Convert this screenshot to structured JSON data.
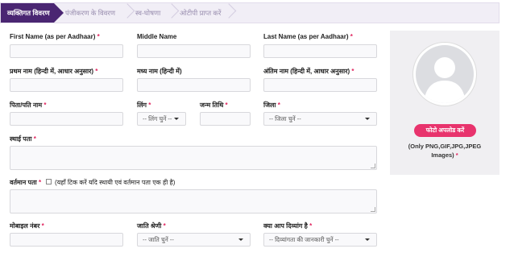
{
  "wizard": {
    "steps": [
      "व्यक्तिगत विवरण",
      "पंजीकरण के विवरण",
      "स्व-घोषणा",
      "ओटीपी प्राप्त करें"
    ]
  },
  "form": {
    "first_name_label": "First Name (as per Aadhaar)",
    "middle_name_label": "Middle Name",
    "last_name_label": "Last Name (as per Aadhaar)",
    "first_name_hi_label": "प्रथम नाम (हिन्दी में, आधार अनुसार)",
    "middle_name_hi_label": "मध्य नाम (हिन्दी में)",
    "last_name_hi_label": "अंतिम नाम (हिन्दी में, आधार अनुसार)",
    "father_husband_label": "पिता/पति नाम",
    "gender_label": "लिंग",
    "gender_placeholder": "-- लिंग चुनें --",
    "dob_label": "जन्म तिथि",
    "district_label": "जिला",
    "district_placeholder": "-- जिला चुनें --",
    "permanent_address_label": "स्थाई पता",
    "current_address_label": "वर्तमान पता",
    "same_address_note": "(यहाँ टिक करें यदि स्थायी एवं वर्तमान पता एक ही है)",
    "mobile_label": "मोबाइल नंबर",
    "caste_label": "जाति श्रेणी",
    "caste_placeholder": "-- जाति चुनें --",
    "disabled_label": "क्या आप दिव्यांग है",
    "disabled_placeholder": "-- दिव्यांगता की जानकारी चुनें --",
    "required_mark": "*"
  },
  "photo": {
    "upload_label": "फोटो अपलोड करें",
    "note": "(Only PNG,GIF,JPG,JPEG Images)"
  },
  "colors": {
    "active_step": "#4a2672",
    "required": "#e0245e",
    "upload_button": "#e8336d"
  }
}
